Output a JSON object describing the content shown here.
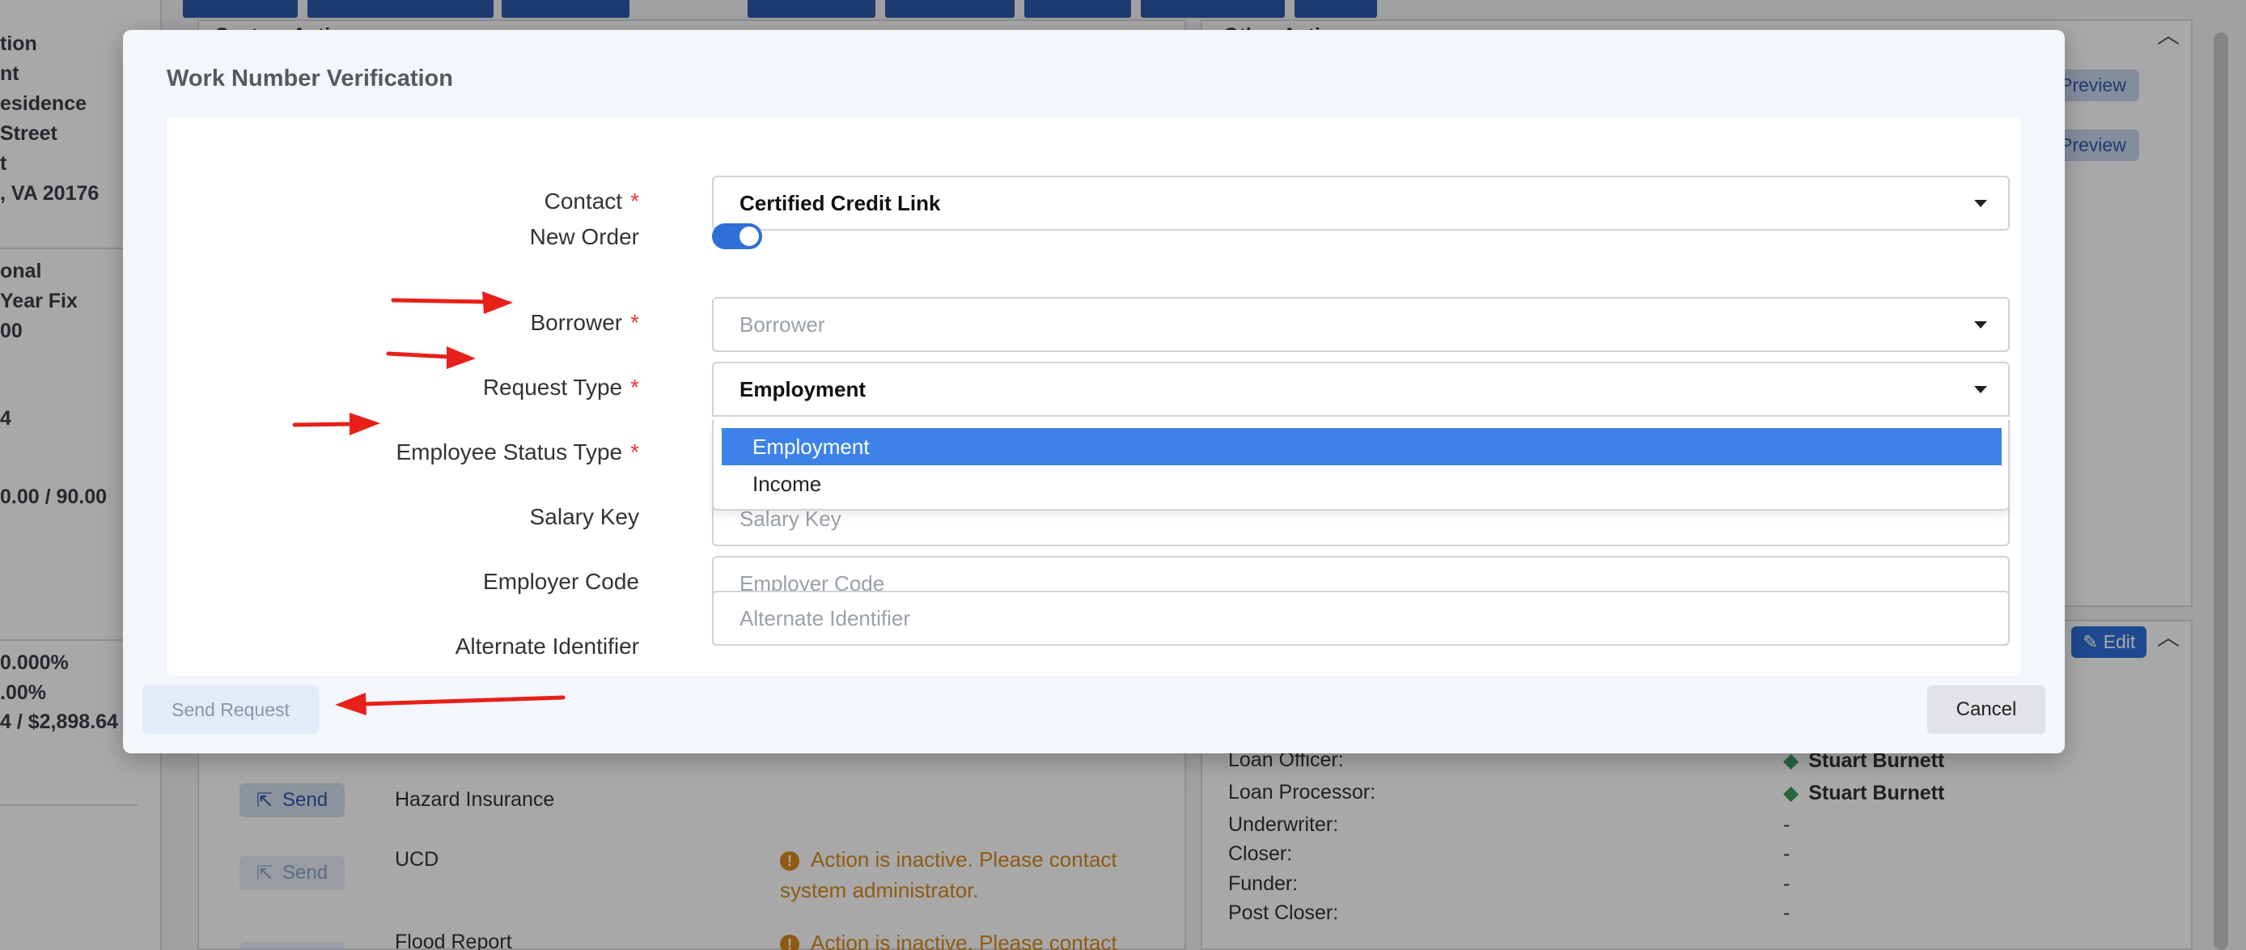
{
  "background": {
    "left_lines": [
      "tion",
      "nt",
      "esidence",
      "Street",
      "t",
      ", VA 20176",
      "onal",
      "Year Fix",
      "00",
      "4",
      "0.00 / 90.00",
      "0.000%",
      ".00%",
      "4 / $2,898.64"
    ],
    "top_section_left": "System Actions",
    "top_section_right": "Other Actions",
    "preview_label": "Preview",
    "edit_label": "Edit",
    "send_label": "Send",
    "actions": [
      {
        "name": "Hazard Insurance",
        "warning": ""
      },
      {
        "name": "UCD",
        "warning": "Action is inactive. Please contact system administrator."
      },
      {
        "name": "Flood Report",
        "warning": "Action is inactive. Please contact"
      }
    ],
    "team": [
      {
        "role": "Loan Officer:",
        "value": "Stuart Burnett"
      },
      {
        "role": "Loan Processor:",
        "value": "Stuart Burnett"
      },
      {
        "role": "Underwriter:",
        "value": "-"
      },
      {
        "role": "Closer:",
        "value": "-"
      },
      {
        "role": "Funder:",
        "value": "-"
      },
      {
        "role": "Post Closer:",
        "value": "-"
      }
    ]
  },
  "modal": {
    "title": "Work Number Verification",
    "fields": {
      "contact": {
        "label": "Contact",
        "value": "Certified Credit Link"
      },
      "new_order": {
        "label": "New Order",
        "on": true
      },
      "borrower": {
        "label": "Borrower",
        "placeholder": "Borrower"
      },
      "request_type": {
        "label": "Request Type",
        "value": "Employment"
      },
      "employee_status_type": {
        "label": "Employee Status Type"
      },
      "salary_key": {
        "label": "Salary Key",
        "placeholder": "Salary Key"
      },
      "employer_code": {
        "label": "Employer Code",
        "placeholder": "Employer Code"
      },
      "alternate_identifier": {
        "label": "Alternate Identifier",
        "placeholder": "Alternate Identifier"
      }
    },
    "required_mark": "*",
    "dropdown_options": [
      {
        "label": "Employment",
        "selected": true
      },
      {
        "label": "Income",
        "selected": false
      }
    ],
    "send_request_label": "Send Request",
    "cancel_label": "Cancel"
  },
  "colors": {
    "accent": "#2e6fd8",
    "selected_option": "#3d82e8",
    "required": "#e53935",
    "annotation_arrow": "#e8201a",
    "warning": "#d98b1d"
  }
}
